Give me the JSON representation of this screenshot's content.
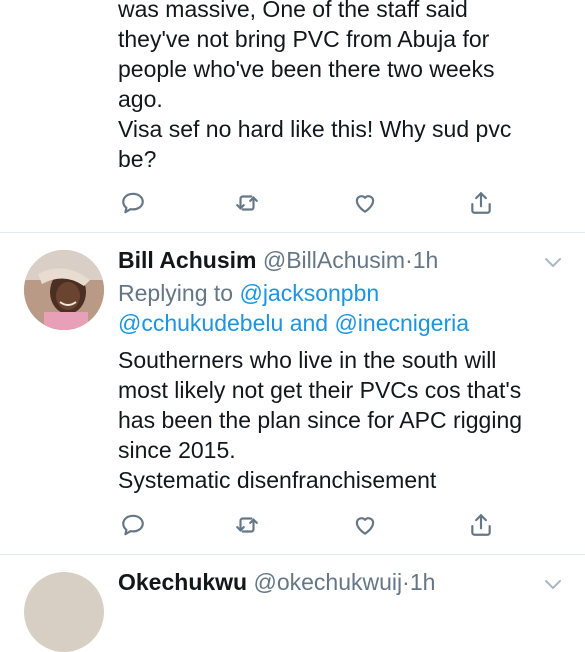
{
  "tweet1": {
    "text_lines": [
      "was massive, One of the staff said",
      "they've not bring PVC from Abuja for",
      "people who've been there two weeks",
      "ago.",
      "Visa sef no hard like this! Why sud pvc",
      "be?"
    ]
  },
  "tweet2": {
    "name": "Bill Achusim",
    "handle": "@BillAchusim",
    "separator": "·",
    "time": "1h",
    "replying_prefix": "Replying to",
    "replying_to_1": "@jacksonpbn",
    "replying_to_2": "@cchukudebelu",
    "replying_and": "and",
    "replying_to_3": "@inecnigeria",
    "text_lines": [
      "Southerners who live in the south will",
      "most likely not get their PVCs cos that's",
      "has been the plan since for APC rigging",
      "since 2015.",
      "Systematic disenfranchisement"
    ]
  },
  "tweet3": {
    "name": "Okechukwu",
    "handle": "@okechukwuij",
    "separator": "·",
    "time": "1h"
  },
  "icons": {
    "reply": "reply-icon",
    "retweet": "retweet-icon",
    "like": "heart-icon",
    "share": "share-icon",
    "caret": "chevron-down-icon"
  },
  "colors": {
    "link": "#1b95e0",
    "secondary": "#657786",
    "divider": "#e1e8ed"
  }
}
